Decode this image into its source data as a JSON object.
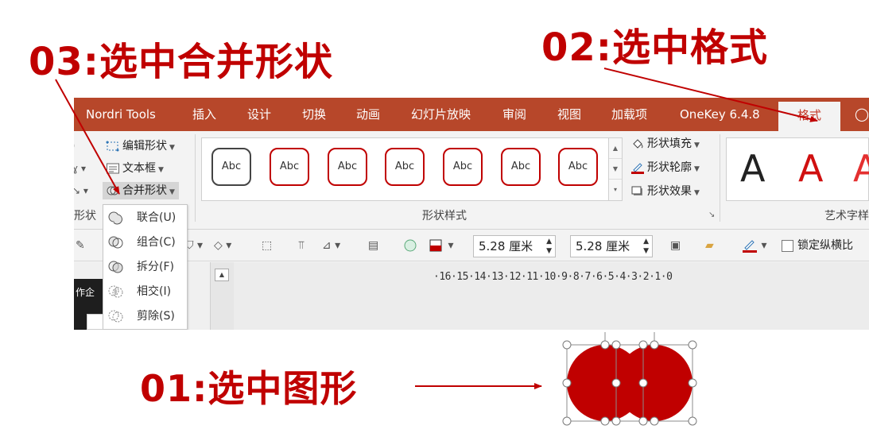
{
  "annotations": {
    "step03": "03:选中合并形状",
    "step02": "02:选中格式",
    "step01": "01:选中图形"
  },
  "colors": {
    "accent": "#c00000",
    "tabbar": "#b7472a",
    "shape_fill": "#c00000"
  },
  "tabs": [
    {
      "label": "Nordri Tools"
    },
    {
      "label": "插入"
    },
    {
      "label": "设计"
    },
    {
      "label": "切换"
    },
    {
      "label": "动画"
    },
    {
      "label": "幻灯片放映"
    },
    {
      "label": "审阅"
    },
    {
      "label": "视图"
    },
    {
      "label": "加载项"
    },
    {
      "label": "OneKey 6.4.8"
    },
    {
      "label": "格式",
      "active": true
    }
  ],
  "tell_me_icon": "lightbulb-icon",
  "insert_shapes": {
    "edit_shape": "编辑形状",
    "text_box": "文本框",
    "merge_shapes": "合并形状",
    "group_label_partial": "形状"
  },
  "shape_styles": {
    "sample_text": "Abc",
    "fill": "形状填充",
    "outline": "形状轮廓",
    "effects": "形状效果",
    "group_label": "形状样式"
  },
  "wordart": {
    "sample_letter": "A",
    "group_label_partial": "艺术字样"
  },
  "size": {
    "height_value": "5.28 厘米",
    "width_value": "5.28 厘米",
    "lock_ratio_label": "锁定纵横比"
  },
  "ruler_text": "·16·15·14·13·12·11·10·9·8·7·6·5·4·3·2·1·0",
  "panel_text": "作企",
  "merge_menu": [
    {
      "label": "联合(U)",
      "icon": "union-icon"
    },
    {
      "label": "组合(C)",
      "icon": "combine-icon"
    },
    {
      "label": "拆分(F)",
      "icon": "fragment-icon"
    },
    {
      "label": "相交(I)",
      "icon": "intersect-icon"
    },
    {
      "label": "剪除(S)",
      "icon": "subtract-icon"
    }
  ]
}
